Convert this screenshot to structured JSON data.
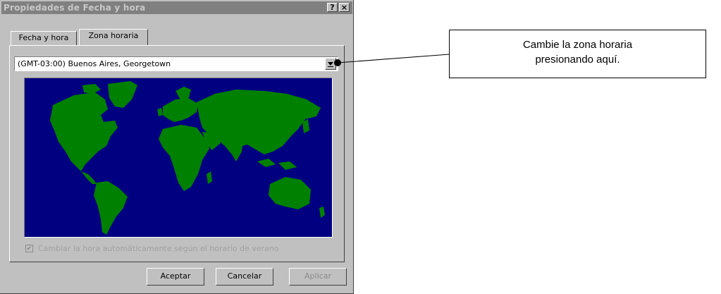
{
  "window": {
    "title": "Propiedades de Fecha y hora",
    "help_button": "?",
    "close_button": "×"
  },
  "tabs": [
    {
      "label": "Fecha y hora",
      "active": false
    },
    {
      "label": "Zona horaria",
      "active": true
    }
  ],
  "timezone": {
    "selected": "(GMT-03:00) Buenos Aires, Georgetown"
  },
  "map": {
    "ocean_color": "#000080",
    "land_color": "#008000"
  },
  "dst": {
    "checked": true,
    "checkmark": "✔",
    "label": "Cambiar la hora automáticamente según el horario de verano"
  },
  "buttons": {
    "ok": "Aceptar",
    "cancel": "Cancelar",
    "apply": "Aplicar"
  },
  "callout": {
    "text_line1": "Cambie la zona horaria",
    "text_line2": "presionando aquí."
  }
}
